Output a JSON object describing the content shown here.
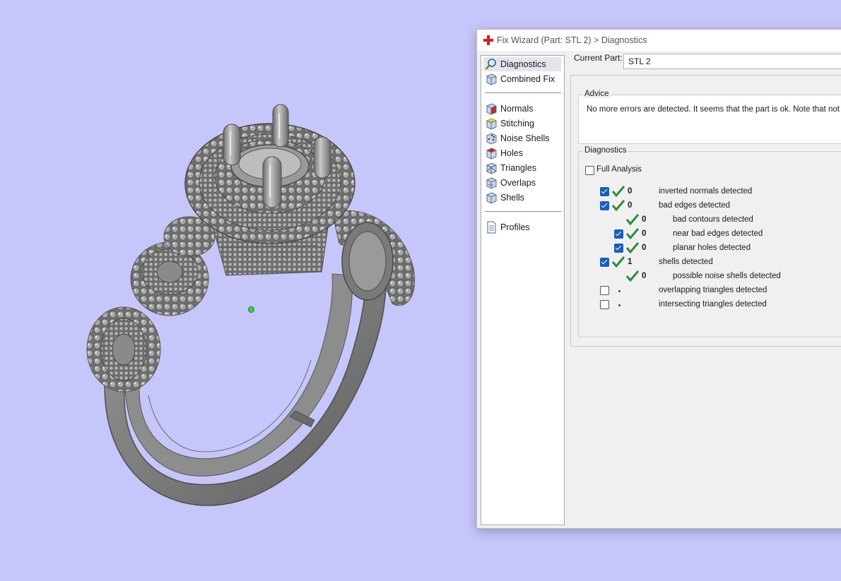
{
  "window": {
    "title": "Fix Wizard (Part: STL 2) > Diagnostics"
  },
  "nav": {
    "items": [
      {
        "label": "Diagnostics",
        "icon": "magnifier-icon",
        "selected": true
      },
      {
        "label": "Combined Fix",
        "icon": "cube-icon"
      },
      {
        "label": "Normals",
        "icon": "cube-normals-icon"
      },
      {
        "label": "Stitching",
        "icon": "cube-stitching-icon"
      },
      {
        "label": "Noise Shells",
        "icon": "cube-noise-icon"
      },
      {
        "label": "Holes",
        "icon": "cube-holes-icon"
      },
      {
        "label": "Triangles",
        "icon": "cube-triangles-icon"
      },
      {
        "label": "Overlaps",
        "icon": "cube-overlaps-icon"
      },
      {
        "label": "Shells",
        "icon": "cube-shells-icon"
      },
      {
        "label": "Profiles",
        "icon": "document-icon"
      }
    ]
  },
  "current_part": {
    "label": "Current Part:",
    "value": "STL 2"
  },
  "advice": {
    "title": "Advice",
    "text": "No more errors are detected. It seems that the part is ok. Note that not all"
  },
  "diagnostics": {
    "title": "Diagnostics",
    "full_analysis_label": "Full Analysis",
    "full_analysis_checked": false,
    "rows": [
      {
        "label": "inverted normals detected",
        "count": "0",
        "checkbox": true,
        "checked": true,
        "status": "ok",
        "level": 0
      },
      {
        "label": "bad edges detected",
        "count": "0",
        "checkbox": true,
        "checked": true,
        "status": "ok",
        "level": 0
      },
      {
        "label": "bad contours detected",
        "count": "0",
        "checkbox": false,
        "checked": false,
        "status": "ok",
        "level": 1
      },
      {
        "label": "near bad edges detected",
        "count": "0",
        "checkbox": true,
        "checked": true,
        "status": "ok",
        "level": 1
      },
      {
        "label": "planar holes detected",
        "count": "0",
        "checkbox": true,
        "checked": true,
        "status": "ok",
        "level": 1
      },
      {
        "label": "shells detected",
        "count": "1",
        "checkbox": true,
        "checked": true,
        "status": "ok",
        "level": 0
      },
      {
        "label": "possible noise shells detected",
        "count": "0",
        "checkbox": false,
        "checked": false,
        "status": "ok",
        "level": 1
      },
      {
        "label": "overlapping triangles detected",
        "count": "",
        "checkbox": true,
        "checked": false,
        "status": "pending",
        "level": 0
      },
      {
        "label": "intersecting triangles detected",
        "count": "",
        "checkbox": true,
        "checked": false,
        "status": "pending",
        "level": 0
      }
    ]
  },
  "colors": {
    "viewport_background": "#c6c6fb",
    "model_gray": "#8a8a8a",
    "check_green": "#2e8b3e",
    "checkbox_blue": "#1a5fb4"
  }
}
